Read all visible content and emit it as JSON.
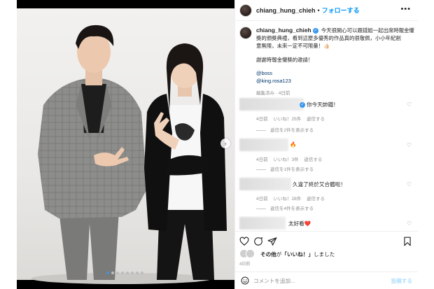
{
  "header": {
    "username": "chiang_hung_chieh",
    "separator": "•",
    "follow_label": "フォローする",
    "more_label": "•••"
  },
  "caption": {
    "username": "chiang_hung_chieh",
    "lines": [
      "今天很開心可以跟錢姐一起出席時報金懽",
      "獎的頒獎典禮，看到這麼多優秀的作品真的很敬佩，小小年紀創",
      "意無限，未來一定不可限量！👍🏻"
    ],
    "thanks": "謝謝時報金懽獎的邀請！",
    "mentions": [
      "@boss",
      "@king.rosa123"
    ],
    "meta": "編集済み · 4日前"
  },
  "comments": [
    {
      "text": "你今天帥鐵！",
      "time": "4日前",
      "likes": "いいね！25件",
      "reply": "返信する",
      "replies": "返信を2件を表示する"
    },
    {
      "text": "🔥",
      "time": "4日前",
      "likes": "いいね！3件",
      "reply": "返信する",
      "replies": "返信を1件を表示する"
    },
    {
      "text": "久違了終於又合體啦！",
      "time": "4日前",
      "likes": "いいね！28件",
      "reply": "返信する",
      "replies": "返信を4件を表示する"
    },
    {
      "text": "太好看❤️",
      "time": "",
      "likes": "",
      "reply": "",
      "replies": ""
    }
  ],
  "likes_summary": {
    "prefix_name": "その他",
    "middle": "が",
    "quoted": "「いいね！」",
    "suffix": "しました"
  },
  "post_date": "4日前",
  "comment_box": {
    "placeholder": "コメントを追加...",
    "post_label": "投稿する"
  },
  "carousel": {
    "dots": 8,
    "active_index": 0,
    "next_label": "›"
  },
  "colors": {
    "accent": "#0095f6",
    "verified": "#3897f0",
    "muted": "#8e8e8e"
  },
  "icons": [
    "more-icon",
    "verified-icon",
    "heart-icon",
    "comment-icon",
    "share-icon",
    "bookmark-icon",
    "emoji-icon",
    "chevron-right-icon"
  ]
}
